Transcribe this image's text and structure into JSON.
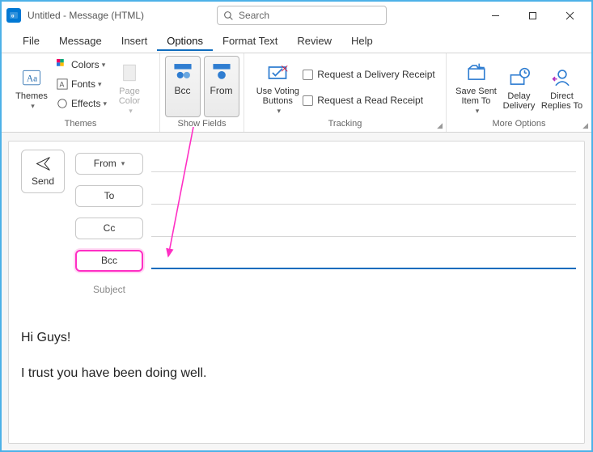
{
  "window": {
    "title": "Untitled  -  Message (HTML)",
    "search_placeholder": "Search"
  },
  "menu": {
    "file": "File",
    "message": "Message",
    "insert": "Insert",
    "options": "Options",
    "format_text": "Format Text",
    "review": "Review",
    "help": "Help"
  },
  "ribbon": {
    "themes": {
      "group": "Themes",
      "themes": "Themes",
      "colors": "Colors",
      "fonts": "Fonts",
      "effects": "Effects",
      "page_color": "Page\nColor"
    },
    "show_fields": {
      "group": "Show Fields",
      "bcc": "Bcc",
      "from": "From"
    },
    "tracking": {
      "group": "Tracking",
      "voting": "Use Voting\nButtons",
      "delivery": "Request a Delivery Receipt",
      "read": "Request a Read Receipt"
    },
    "more": {
      "group": "More Options",
      "save_sent": "Save Sent\nItem To",
      "delay": "Delay\nDelivery",
      "direct": "Direct\nReplies To"
    }
  },
  "compose": {
    "send": "Send",
    "from": "From",
    "to": "To",
    "cc": "Cc",
    "bcc": "Bcc",
    "subject": "Subject",
    "body_line1": "Hi Guys!",
    "body_line2": "I trust you have been doing well."
  }
}
